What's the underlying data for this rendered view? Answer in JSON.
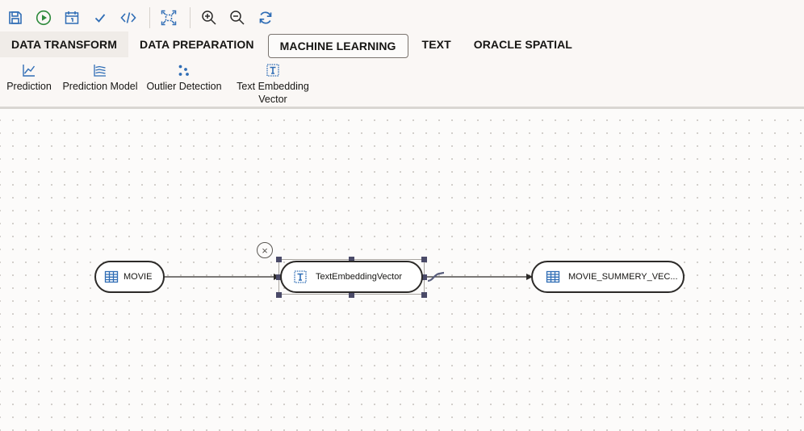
{
  "toolbar": {
    "buttons": [
      {
        "name": "save",
        "icon": "save-icon"
      },
      {
        "name": "run",
        "icon": "play-icon"
      },
      {
        "name": "schedule",
        "icon": "calendar-icon"
      },
      {
        "name": "validate",
        "icon": "check-icon"
      },
      {
        "name": "code",
        "icon": "code-icon"
      },
      {
        "name": "fit",
        "icon": "fit-to-screen-icon"
      },
      {
        "name": "zoom-in",
        "icon": "zoom-in-icon"
      },
      {
        "name": "zoom-out",
        "icon": "zoom-out-icon"
      },
      {
        "name": "refresh",
        "icon": "refresh-icon"
      }
    ],
    "colors": {
      "blue": "#2f6db5",
      "green": "#2e8a3c"
    }
  },
  "tabs": [
    {
      "label": "DATA TRANSFORM"
    },
    {
      "label": "DATA PREPARATION"
    },
    {
      "label": "MACHINE LEARNING",
      "active": true
    },
    {
      "label": "TEXT"
    },
    {
      "label": "ORACLE SPATIAL"
    }
  ],
  "palette": {
    "items": [
      {
        "label": "Prediction",
        "icon": "line-chart-icon"
      },
      {
        "label": "Prediction Model",
        "icon": "multi-line-chart-icon"
      },
      {
        "label": "Outlier Detection",
        "icon": "scatter-dots-icon"
      },
      {
        "label": "Text Embedding",
        "label2": "Vector",
        "icon": "text-box-icon"
      }
    ]
  },
  "canvas": {
    "nodes": [
      {
        "label": "MOVIE",
        "icon": "table-icon"
      },
      {
        "label": "TextEmbeddingVector",
        "icon": "text-box-icon",
        "selected": true
      },
      {
        "label": "MOVIE_SUMMERY_VEC...",
        "icon": "table-icon"
      }
    ],
    "close_symbol": "×",
    "edge_color": "#2c2a28",
    "icon_color": "#2f6db5"
  }
}
